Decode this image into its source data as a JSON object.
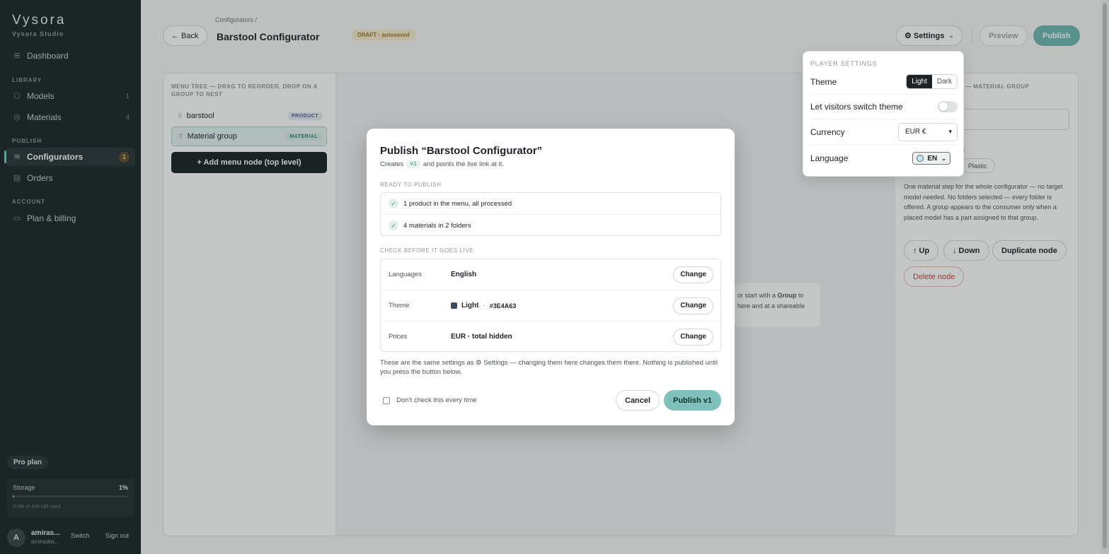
{
  "sidebar": {
    "brand": "Vysora",
    "brand_sub": "Vysora Studio",
    "dashboard": "Dashboard",
    "library_label": "LIBRARY",
    "models": "Models",
    "models_count": "1",
    "materials": "Materials",
    "materials_count": "4",
    "publish_label": "PUBLISH",
    "configurators": "Configurators",
    "configurators_count": "1",
    "orders": "Orders",
    "account_label": "ACCOUNT",
    "plan_billing": "Plan & billing",
    "plan_badge": "Pro plan",
    "storage_label": "Storage",
    "storage_pct": "1%",
    "storage_fraction": 0.01,
    "storage_used": "3 MB of 419 MB used",
    "user_initial": "A",
    "user_name": "amiras...",
    "user_email": "amiraska...",
    "switch": "Switch",
    "sign_out": "Sign out"
  },
  "header": {
    "breadcrumb": "Configurators  /",
    "back": "← Back",
    "title": "Barstool Configurator",
    "draft_badge": "DRAFT · autosaved",
    "settings": "⚙ Settings",
    "settings_caret": "⌄",
    "preview": "Preview",
    "publish": "Publish"
  },
  "tree": {
    "heading": "MENU TREE — DRAG TO REORDER, DROP ON A GROUP TO NEST",
    "items": [
      {
        "label": "barstool",
        "tag": "PRODUCT"
      },
      {
        "label": "Material group",
        "tag": "MATERIAL"
      }
    ],
    "add_button": "+ Add menu node (top level)"
  },
  "canvas": {
    "hint_line1_a": "or start with a ",
    "hint_line1_b": "Group",
    "hint_line1_c": " to",
    "hint_line2": "here and at a shareable"
  },
  "props": {
    "heading": "— MATERIAL GROUP",
    "small": "ered",
    "chip": "Plastic",
    "description": "One material step for the whole configurator — no target model needed. No folders selected — every folder is offered. A group appears to the consumer only when a placed model has a part assigned to that group.",
    "up": "↑ Up",
    "down": "↓ Down",
    "duplicate": "Duplicate node",
    "delete": "Delete node"
  },
  "settings_popover": {
    "heading": "PLAYER SETTINGS",
    "theme_label": "Theme",
    "theme_options": [
      "Light",
      "Dark"
    ],
    "theme_selected": "Light",
    "switch_label": "Let visitors switch theme",
    "switch_on": false,
    "currency_label": "Currency",
    "currency_value": "EUR €",
    "language_label": "Language",
    "language_value": "EN",
    "language_caret": "⌄"
  },
  "modal": {
    "title": "Publish “Barstool Configurator”",
    "sub_pre": "Creates",
    "sub_code": "v1",
    "sub_post": "and points the live link at it.",
    "ready_label": "READY TO PUBLISH",
    "ready_items": [
      "1 product in the menu, all processed",
      "4 materials in 2 folders"
    ],
    "check_label": "CHECK BEFORE IT GOES LIVE",
    "languages_key": "Languages",
    "languages_val": "English",
    "theme_key": "Theme",
    "theme_val": "Light",
    "theme_sep": "·",
    "theme_hex": "#3E4A63",
    "theme_color": "#3E4A63",
    "prices_key": "Prices",
    "prices_val": "EUR · total hidden",
    "change": "Change",
    "note": "These are the same settings as ⚙ Settings — changing them here changes them there. Nothing is published until you press the button below.",
    "dont_check": "Don’t check this every time",
    "cancel": "Cancel",
    "publish": "Publish v1"
  },
  "colors": {
    "accent": "#6fb8b0",
    "sidebar_bg": "#1d2729",
    "draft_badge": "#f6e8c8",
    "danger": "#c0463c"
  }
}
